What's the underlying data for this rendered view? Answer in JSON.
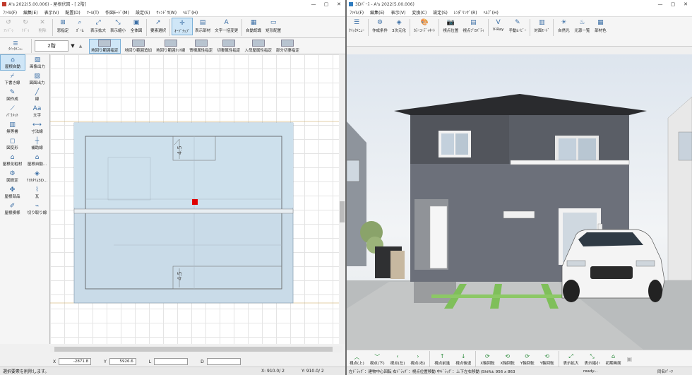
{
  "left": {
    "title": "A's 2022(5.00.006) - 屋根伏図 - [ 2階]",
    "menu": [
      "ﾌｧｲﾙ(F)",
      "編集(E)",
      "表示(V)",
      "配置(D)",
      "ﾂｰﾙ(T)",
      "作図ﾓｰﾄﾞ(M)",
      "設定(S)",
      "ｳｨﾝﾄﾞｳ(W)",
      "ﾍﾙﾌﾟ(H)"
    ],
    "toolbar": [
      {
        "icon": "undo-icon",
        "glyph": "↺",
        "label": "ｱﾝﾄﾞｩ",
        "disabled": true
      },
      {
        "icon": "redo-icon",
        "glyph": "↻",
        "label": "ﾘﾄﾞｩ",
        "disabled": true
      },
      {
        "icon": "delete-icon",
        "glyph": "✕",
        "label": "削除",
        "disabled": true
      },
      {
        "icon": "region-select-icon",
        "glyph": "⊞",
        "label": "窓指定"
      },
      {
        "icon": "zoom-icon",
        "glyph": "⌕",
        "label": "ｽﾞｰﾑ"
      },
      {
        "icon": "zoom-in-icon",
        "glyph": "⤢",
        "label": "表示拡大"
      },
      {
        "icon": "zoom-out-icon",
        "glyph": "⤡",
        "label": "表示縮小"
      },
      {
        "icon": "full-view-icon",
        "glyph": "▣",
        "label": "全体図"
      },
      {
        "icon": "element-select-icon",
        "glyph": "➚",
        "label": "要素選択"
      },
      {
        "icon": "osnap-icon",
        "glyph": "✛",
        "label": "ｵｰｿﾞﾅｯﾌﾟ",
        "selected": true
      },
      {
        "icon": "display-parts-icon",
        "glyph": "▤",
        "label": "表示部材"
      },
      {
        "icon": "text-change-icon",
        "glyph": "A",
        "label": "文字一括変更"
      },
      {
        "icon": "auto-recognize-icon",
        "glyph": "▦",
        "label": "自動認識"
      },
      {
        "icon": "rect-place-icon",
        "glyph": "▭",
        "label": "矩形配置"
      }
    ],
    "quick_menu": "ｸｲｯｸﾒﾆｭｰ",
    "floor": "2階",
    "modes": [
      {
        "label": "地回り範囲指定",
        "selected": true
      },
      {
        "label": "地回り範囲追加"
      },
      {
        "label": "地回り範囲ｶｯﾄ線"
      },
      {
        "label": "寄棟属性指定"
      },
      {
        "label": "切妻属性指定"
      },
      {
        "label": "入母屋属性指定"
      },
      {
        "label": "部分切妻指定"
      }
    ],
    "sidebar": [
      {
        "icon": "roof-auto-icon",
        "glyph": "⌂",
        "label": "屋根自動",
        "selected": true
      },
      {
        "icon": "image-output-icon",
        "glyph": "▧",
        "label": "画像出力"
      },
      {
        "icon": "draft-line-icon",
        "glyph": "⌿",
        "label": "下書き線"
      },
      {
        "icon": "plan-output-icon",
        "glyph": "▨",
        "label": "図面出力"
      },
      {
        "icon": "drawing-icon",
        "glyph": "✎",
        "label": "図作成"
      },
      {
        "icon": "line-icon",
        "glyph": "╱",
        "label": "線"
      },
      {
        "icon": "pattern-icon",
        "glyph": "⟋",
        "label": "ﾊﾟﾗﾒｯﾄ"
      },
      {
        "icon": "text-icon",
        "glyph": "Aa",
        "label": "文字"
      },
      {
        "icon": "unsaved-icon",
        "glyph": "▥",
        "label": "無等書"
      },
      {
        "icon": "dimension-icon",
        "glyph": "⟷",
        "label": "寸法線"
      },
      {
        "icon": "shape-icon",
        "glyph": "◻",
        "label": "図変形"
      },
      {
        "icon": "aux-line-icon",
        "glyph": "┼",
        "label": "補助線"
      },
      {
        "icon": "roof-material-icon",
        "glyph": "⌂",
        "label": "屋根化粧材"
      },
      {
        "icon": "roof-auto2-icon",
        "glyph": "⌂",
        "label": "屋根自動..."
      },
      {
        "icon": "settings-diagram-icon",
        "glyph": "⚙",
        "label": "図設定"
      },
      {
        "icon": "realtime-3d-icon",
        "glyph": "◈",
        "label": "ﾘｱﾙﾀｲﾑ3D..."
      },
      {
        "icon": "roof-parts-icon",
        "glyph": "✤",
        "label": "屋根部品"
      },
      {
        "icon": "tile-icon",
        "glyph": "⌇",
        "label": "瓦"
      },
      {
        "icon": "roof-template-icon",
        "glyph": "✐",
        "label": "屋根模様"
      },
      {
        "icon": "cut-line-icon",
        "glyph": "⌁",
        "label": "切り取り線"
      }
    ],
    "coords": {
      "x_label": "X",
      "x_value": "-2871.8",
      "y_label": "Y",
      "y_value": "5926.6",
      "l_label": "L",
      "d_label": "D"
    },
    "status": {
      "message": "選択要素を削除します。",
      "x": "X:  910.0/ 2",
      "y": "Y:  910.0/ 2"
    },
    "dim_top": "4.5",
    "dim_bottom": "4.5"
  },
  "right": {
    "title": "3Dﾊﾟｰｽ - A's 2022(5.00.006)",
    "menu": [
      "ﾌｧｲﾙ(F)",
      "編集(E)",
      "表示(V)",
      "変換(C)",
      "設定(S)",
      "ﾚﾝﾀﾞﾘﾝｸﾞ(R)",
      "ﾍﾙﾌﾟ(H)"
    ],
    "toolbar": [
      {
        "icon": "quick-menu-icon",
        "glyph": "☰",
        "label": "ｸｲｯｸﾒﾆｭｰ"
      },
      {
        "icon": "create-conditions-icon",
        "glyph": "⚙",
        "label": "作成条件"
      },
      {
        "icon": "3d-icon",
        "glyph": "◈",
        "label": "3次元化"
      },
      {
        "icon": "color-coordinate-icon",
        "glyph": "🎨",
        "label": "ｶﾗｰｺｰﾃﾞｨﾈｰﾄ"
      },
      {
        "icon": "camera-icon",
        "glyph": "📷",
        "label": "視点位置"
      },
      {
        "icon": "view-property-icon",
        "glyph": "▤",
        "label": "視点ﾌﾟﾛﾊﾟﾃｨ"
      },
      {
        "icon": "vray-icon",
        "glyph": "V",
        "label": "V-Ray"
      },
      {
        "icon": "manual-movie-icon",
        "glyph": "✎",
        "label": "手動ﾑｰﾋﾞｰ"
      },
      {
        "icon": "opposite-mode-icon",
        "glyph": "▥",
        "label": "対面ﾓｰﾄﾞ"
      },
      {
        "icon": "natural-light-icon",
        "glyph": "☀",
        "label": "自然光"
      },
      {
        "icon": "light-source-icon",
        "glyph": "♨",
        "label": "光源一覧"
      },
      {
        "icon": "materials-icon",
        "glyph": "▦",
        "label": "部材色"
      }
    ],
    "nav": [
      {
        "icon": "view-up-icon",
        "glyph": "︿",
        "label": "視点(上)"
      },
      {
        "icon": "view-down-icon",
        "glyph": "﹀",
        "label": "視点(下)"
      },
      {
        "icon": "view-left-icon",
        "glyph": "‹",
        "label": "視点(左)"
      },
      {
        "icon": "view-right-icon",
        "glyph": "›",
        "label": "視点(右)"
      },
      {
        "icon": "view-forward-icon",
        "glyph": "↑",
        "label": "視点前進"
      },
      {
        "icon": "view-back-icon",
        "glyph": "↓",
        "label": "視点後退"
      },
      {
        "icon": "x-rotate-icon",
        "glyph": "⟳",
        "label": "X軸回転"
      },
      {
        "icon": "x-rotate2-icon",
        "glyph": "⟲",
        "label": "X軸回転"
      },
      {
        "icon": "y-rotate-icon",
        "glyph": "⟳",
        "label": "Y軸回転"
      },
      {
        "icon": "y-rotate2-icon",
        "glyph": "⟲",
        "label": "Y軸回転"
      },
      {
        "icon": "display-zoom-in-icon",
        "glyph": "⤢",
        "label": "表示拡大"
      },
      {
        "icon": "display-zoom-out-icon",
        "glyph": "⤡",
        "label": "表示縮小"
      },
      {
        "icon": "initial-screen-icon",
        "glyph": "⌂",
        "label": "初期画面"
      },
      {
        "icon": "extra-icon",
        "glyph": "▣",
        "label": "",
        "disabled": true
      }
    ],
    "status": {
      "hint": "左ﾄﾞﾗｯｸﾞ：建物中心回転  右ﾄﾞﾗｯｸﾞ：視点位置移動  中ﾄﾞﾗｯｸﾞ：上下左右移動  (Shift± 956 x 863",
      "ready": "ready...",
      "mode": "同名ﾊﾟｰﾂ"
    }
  }
}
